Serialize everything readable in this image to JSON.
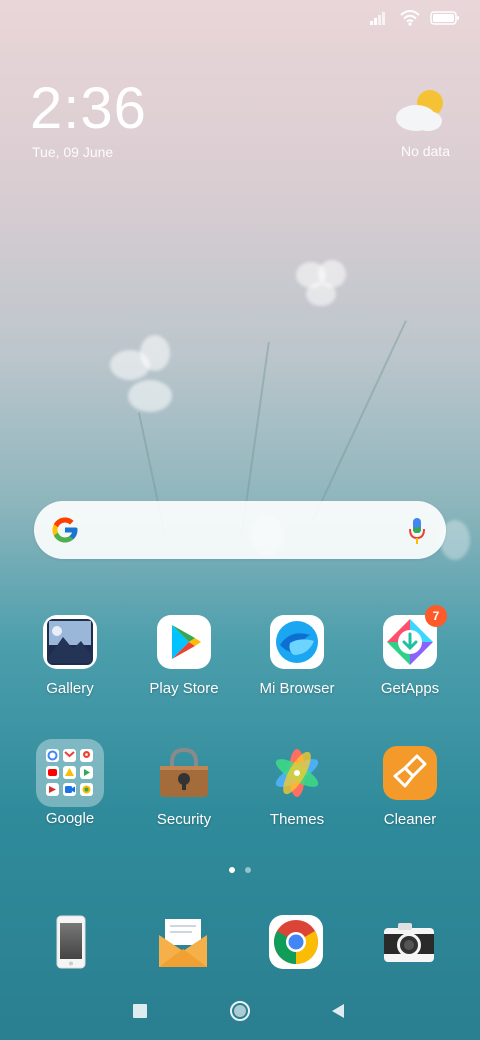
{
  "lockscreen": {
    "time": "2:36",
    "date": "Tue, 09 June",
    "weather_text": "No data",
    "weather_icon": "partly-cloudy-icon"
  },
  "status_bar": {
    "icons": [
      "signal-icon",
      "wifi-icon",
      "battery-icon"
    ]
  },
  "search_bar": {
    "left_icon": "google-g-icon",
    "right_icon": "mic-icon"
  },
  "apps": [
    {
      "label": "Gallery",
      "icon": "gallery-icon"
    },
    {
      "label": "Play Store",
      "icon": "play-store-icon"
    },
    {
      "label": "Mi Browser",
      "icon": "mi-browser-icon"
    },
    {
      "label": "GetApps",
      "icon": "getapps-icon",
      "badge": "7"
    },
    {
      "label": "Google",
      "icon": "google-folder-icon"
    },
    {
      "label": "Security",
      "icon": "security-icon"
    },
    {
      "label": "Themes",
      "icon": "themes-icon"
    },
    {
      "label": "Cleaner",
      "icon": "cleaner-icon"
    }
  ],
  "pager": {
    "pages": 2,
    "active": 1
  },
  "dock": [
    "phone-icon",
    "messages-icon",
    "chrome-icon",
    "camera-icon"
  ],
  "nav_bar": [
    "recents-button",
    "home-button",
    "back-button"
  ],
  "colors": {
    "badge": "#ff5a2a",
    "cleaner": "#f39a2a",
    "google_blue": "#4285F4"
  }
}
